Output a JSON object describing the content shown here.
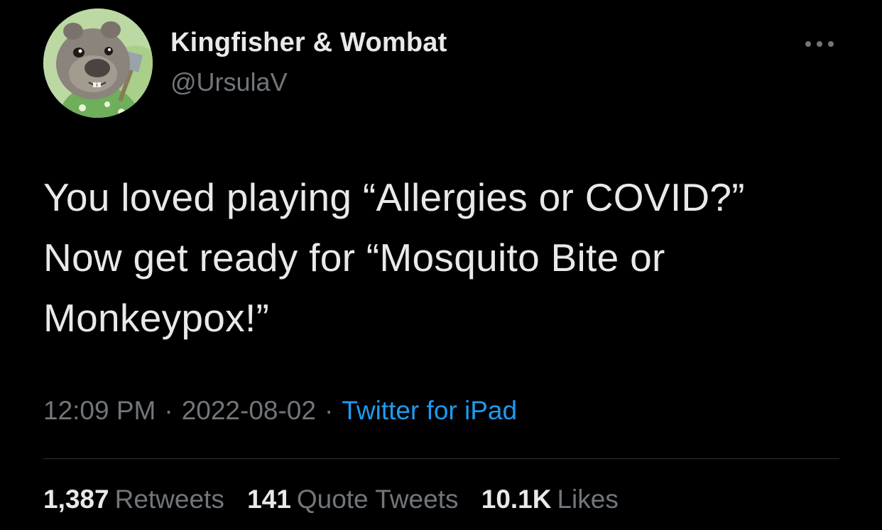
{
  "author": {
    "display_name": "Kingfisher & Wombat",
    "handle": "@UrsulaV",
    "avatar_icon": "wombat-avatar"
  },
  "more_icon": "more-horizontal-icon",
  "tweet": {
    "lines": [
      "You loved playing “Allergies or COVID?”",
      "Now get ready for “Mosquito Bite or",
      "Monkeypox!”"
    ]
  },
  "meta": {
    "time": "12:09 PM",
    "separator": "·",
    "date": "2022-08-02",
    "source": "Twitter for iPad"
  },
  "stats": {
    "retweets": {
      "count": "1,387",
      "label": "Retweets"
    },
    "quotes": {
      "count": "141",
      "label": "Quote Tweets"
    },
    "likes": {
      "count": "10.1K",
      "label": "Likes"
    }
  },
  "colors": {
    "background": "#000000",
    "primary_text": "#e7e9ea",
    "secondary_text": "#71767b",
    "link": "#1d9bf0",
    "divider": "#2f3336"
  }
}
